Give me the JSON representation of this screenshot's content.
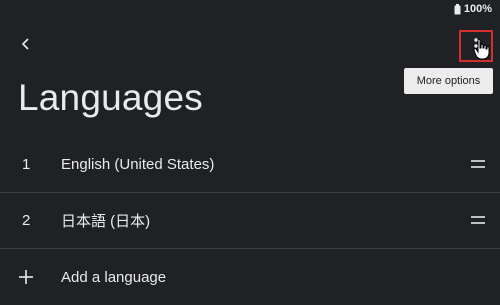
{
  "status_bar": {
    "battery_percent": "100%",
    "battery_icon": "battery-full-icon"
  },
  "header": {
    "back_icon": "chevron-left-icon",
    "more_icon": "more-vert-icon",
    "tooltip": "More options",
    "title": "Languages"
  },
  "languages": [
    {
      "index": "1",
      "name": "English (United States)"
    },
    {
      "index": "2",
      "name": "日本語 (日本)"
    }
  ],
  "add_language": {
    "label": "Add a language",
    "icon": "plus-icon"
  },
  "colors": {
    "background": "#202124",
    "text": "#e8eaed",
    "highlight_border": "#d32f2f",
    "tooltip_bg": "#ececec"
  }
}
